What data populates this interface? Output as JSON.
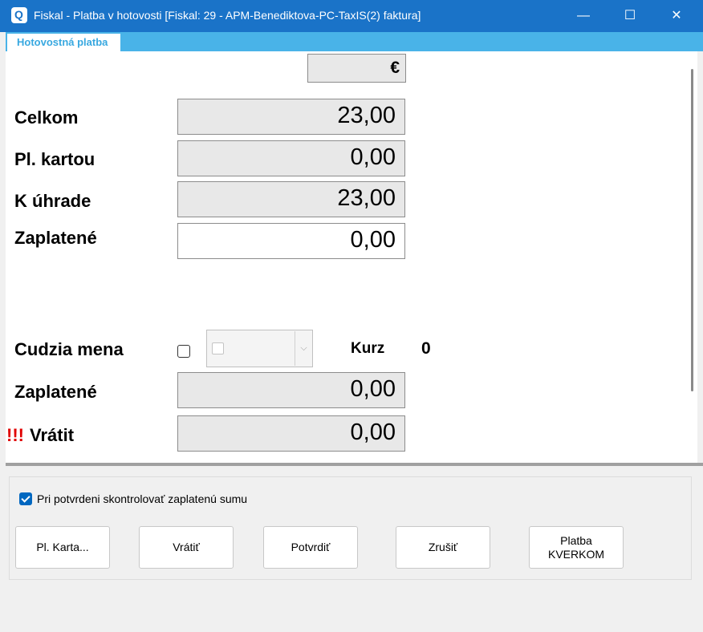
{
  "window": {
    "title": "Fiskal - Platba v hotovosti [Fiskal: 29 - APM-Benediktova-PC-TaxIS(2) faktura]",
    "minimize_glyph": "—",
    "maximize_glyph": "☐",
    "close_glyph": "✕"
  },
  "tab": {
    "label": "Hotovostná platba"
  },
  "currency_symbol": "€",
  "rows": {
    "celkom": {
      "label": "Celkom",
      "value": "23,00"
    },
    "karta": {
      "label": "Pl. kartou",
      "value": "0,00"
    },
    "uhrada": {
      "label": "K úhrade",
      "value": "23,00"
    },
    "zaplatene": {
      "label": "Zaplatené",
      "value": "0,00"
    }
  },
  "foreign": {
    "label": "Cudzia mena",
    "checked": false,
    "rate_label": "Kurz",
    "rate_value": "0",
    "combo_arrow": "⌵",
    "paid_label": "Zaplatené",
    "paid_value": "0,00",
    "return_warning": "!!!",
    "return_label": "Vrátit",
    "return_value": "0,00"
  },
  "verify": {
    "label": "Pri potvrdeni skontrolovať zaplatenú sumu",
    "checked": true
  },
  "buttons": {
    "card": "Pl. Karta...",
    "return": "Vrátiť",
    "confirm": "Potvrdiť",
    "cancel": "Zrušiť",
    "verkom": "Platba\nKVERKOM"
  },
  "colors": {
    "titlebar": "#1a73c8",
    "tab_strip": "#49b3e8",
    "warning": "#e00000"
  }
}
